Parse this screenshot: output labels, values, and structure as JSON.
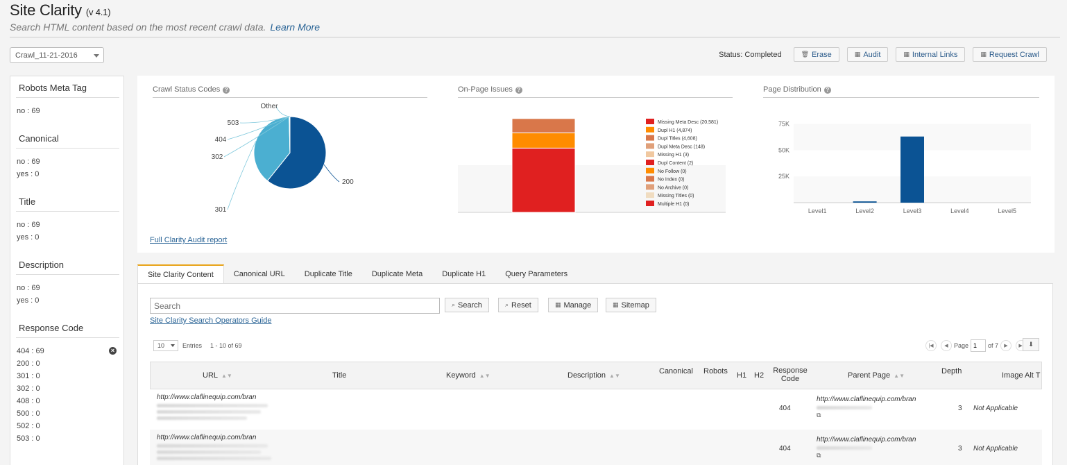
{
  "header": {
    "title": "Site Clarity",
    "version": "(v 4.1)",
    "subtitle": "Search HTML content based on the most recent crawl data.",
    "learn_more": "Learn More"
  },
  "crawl_select": {
    "value": "Crawl_11-21-2016"
  },
  "status": {
    "text": "Status: Completed",
    "buttons": {
      "erase": "Erase",
      "audit": "Audit",
      "internal_links": "Internal Links",
      "request_crawl": "Request Crawl"
    }
  },
  "sidebar": {
    "robots": {
      "title": "Robots Meta Tag",
      "values": [
        "no : 69"
      ]
    },
    "canonical": {
      "title": "Canonical",
      "values": [
        "no : 69",
        "yes : 0"
      ]
    },
    "title_sec": {
      "title": "Title",
      "values": [
        "no : 69",
        "yes : 0"
      ]
    },
    "description": {
      "title": "Description",
      "values": [
        "no : 69",
        "yes : 0"
      ]
    },
    "response": {
      "title": "Response Code",
      "values": [
        "404 : 69",
        "200 : 0",
        "301 : 0",
        "302 : 0",
        "408 : 0",
        "500 : 0",
        "502 : 0",
        "503 : 0"
      ]
    }
  },
  "charts": {
    "crawl_status_title": "Crawl Status Codes",
    "onpage_title": "On-Page Issues",
    "page_dist_title": "Page Distribution",
    "full_audit_link": "Full Clarity Audit report"
  },
  "chart_data": [
    {
      "type": "pie",
      "title": "Crawl Status Codes",
      "categories": [
        "200",
        "301",
        "302",
        "404",
        "503",
        "Other"
      ],
      "values": [
        61,
        39,
        0.1,
        0.1,
        0.1,
        0.1
      ],
      "colors": [
        "#0b5394",
        "#4bafd1",
        "#7ec8dc",
        "#7ec8dc",
        "#7ec8dc",
        "#7ec8dc"
      ]
    },
    {
      "type": "bar",
      "title": "On-Page Issues",
      "stacked": true,
      "series": [
        {
          "name": "Missing Meta Desc (20,581)",
          "value": 20581,
          "color": "#e02020"
        },
        {
          "name": "Dupl H1 (4,874)",
          "value": 4874,
          "color": "#ff8c00"
        },
        {
          "name": "Dupl Titles (4,608)",
          "value": 4608,
          "color": "#d9774a"
        },
        {
          "name": "Dupl Meta Desc (148)",
          "value": 148,
          "color": "#e0a07a"
        },
        {
          "name": "Missing H1 (3)",
          "value": 3,
          "color": "#f0c8a0"
        },
        {
          "name": "Dupl Content (2)",
          "value": 2,
          "color": "#e02020"
        },
        {
          "name": "No Follow (0)",
          "value": 0,
          "color": "#ff8c00"
        },
        {
          "name": "No Index (0)",
          "value": 0,
          "color": "#d9774a"
        },
        {
          "name": "No Archive (0)",
          "value": 0,
          "color": "#e0a07a"
        },
        {
          "name": "Missing Titles (0)",
          "value": 0,
          "color": "#f0dcc0"
        },
        {
          "name": "Multiple H1 (0)",
          "value": 0,
          "color": "#e02020"
        }
      ]
    },
    {
      "type": "bar",
      "title": "Page Distribution",
      "categories": [
        "Level1",
        "Level2",
        "Level3",
        "Level4",
        "Level5"
      ],
      "values": [
        0,
        1200,
        63000,
        0,
        0
      ],
      "yticks": [
        "25K",
        "50K",
        "75K"
      ],
      "ylim": [
        0,
        80000
      ],
      "color": "#0b5394"
    }
  ],
  "tabs": [
    "Site Clarity Content",
    "Canonical URL",
    "Duplicate Title",
    "Duplicate Meta",
    "Duplicate H1",
    "Query Parameters"
  ],
  "search": {
    "placeholder": "Search",
    "buttons": {
      "search": "Search",
      "reset": "Reset",
      "manage": "Manage",
      "sitemap": "Sitemap"
    },
    "guide": "Site Clarity Search Operators Guide"
  },
  "table": {
    "page_size": "10",
    "entries_label": "Entries",
    "range": "1 - 10 of 69",
    "page_label": "Page",
    "page": "1",
    "of_pages": "of 7",
    "columns": {
      "url": "URL",
      "title": "Title",
      "keyword": "Keyword",
      "description": "Description",
      "canonical": "Canonical",
      "robots": "Robots",
      "h1": "H1",
      "h2": "H2",
      "response_code": "Response Code",
      "parent_page": "Parent Page",
      "depth": "Depth",
      "image_alt": "Image Alt T"
    },
    "rows": [
      {
        "url": "http://www.claflinequip.com/bran",
        "code": "404",
        "parent": "http://www.claflinequip.com/bran",
        "depth": "3",
        "image_alt": "Not Applicable"
      },
      {
        "url": "http://www.claflinequip.com/bran",
        "code": "404",
        "parent": "http://www.claflinequip.com/bran",
        "depth": "3",
        "image_alt": "Not Applicable"
      }
    ]
  }
}
